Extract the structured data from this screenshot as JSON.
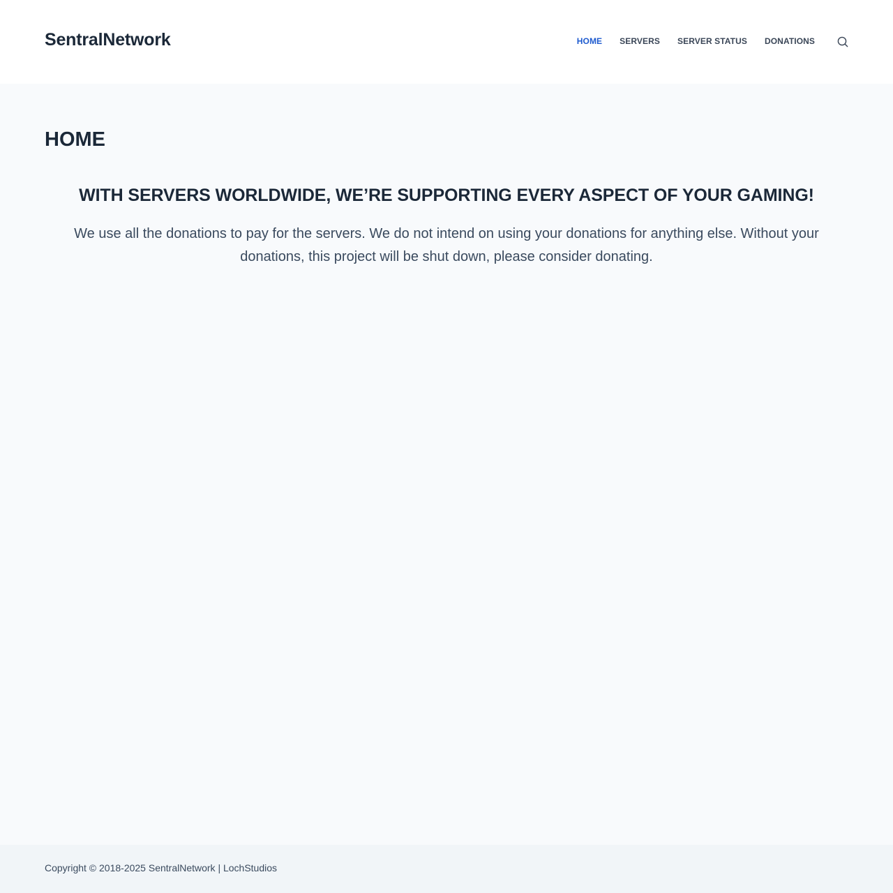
{
  "header": {
    "site_title": "SentralNetwork",
    "nav": [
      {
        "label": "HOME",
        "active": true
      },
      {
        "label": "SERVERS",
        "active": false
      },
      {
        "label": "SERVER STATUS",
        "active": false
      },
      {
        "label": "DONATIONS",
        "active": false
      }
    ],
    "search_icon": "search-icon"
  },
  "main": {
    "page_title": "HOME",
    "heading": "WITH SERVERS WORLDWIDE, WE’RE SUPPORTING EVERY ASPECT OF YOUR GAMING!",
    "text": "We use all the donations to pay for the servers. We do not intend on using your donations for anything else. Without your donations, this project will be shut down, please consider donating."
  },
  "footer": {
    "copyright": "Copyright © 2018-2025 SentralNetwork | LochStudios"
  },
  "colors": {
    "accent": "#1e5bcf",
    "text_dark": "#1b2838",
    "text_body": "#3a4a5e",
    "page_bg": "#f8fafc",
    "footer_bg": "#f1f5f8"
  }
}
